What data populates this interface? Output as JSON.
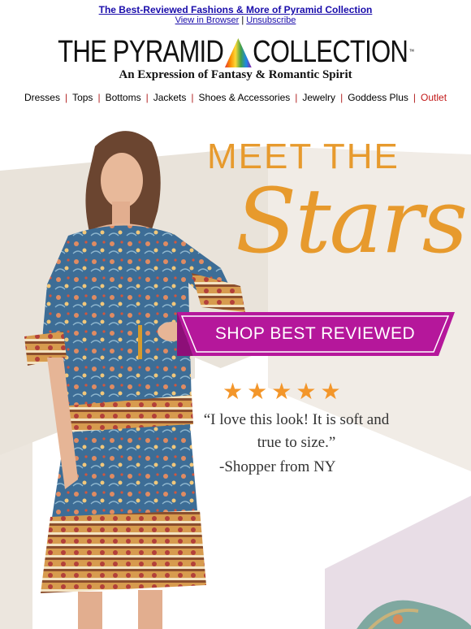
{
  "preheader": {
    "headline": "The Best-Reviewed Fashions & More of Pyramid Collection",
    "view_in_browser": "View in Browser",
    "separator": "|",
    "unsubscribe": "Unsubscribe"
  },
  "logo": {
    "left": "THE PYRAMID",
    "right": "COLLECTION",
    "trademark": "™",
    "tagline": "An Expression of Fantasy & Romantic Spirit"
  },
  "nav": {
    "items": [
      "Dresses",
      "Tops",
      "Bottoms",
      "Jackets",
      "Shoes & Accessories",
      "Jewelry",
      "Goddess Plus",
      "Outlet"
    ],
    "separator": "|"
  },
  "hero": {
    "headline_top": "MEET THE",
    "headline_main": "Stars!",
    "cta_label": "SHOP BEST REVIEWED",
    "rating_stars": 5,
    "star_glyph": "★",
    "quote": "“I love this look! It is soft and true to size.”",
    "attribution": "-Shopper from NY"
  },
  "colors": {
    "accent_orange": "#e79a2d",
    "cta_magenta": "#b5179b",
    "star_orange": "#f3962a",
    "link_blue": "#1a0dab",
    "nav_separator": "#b22222"
  }
}
